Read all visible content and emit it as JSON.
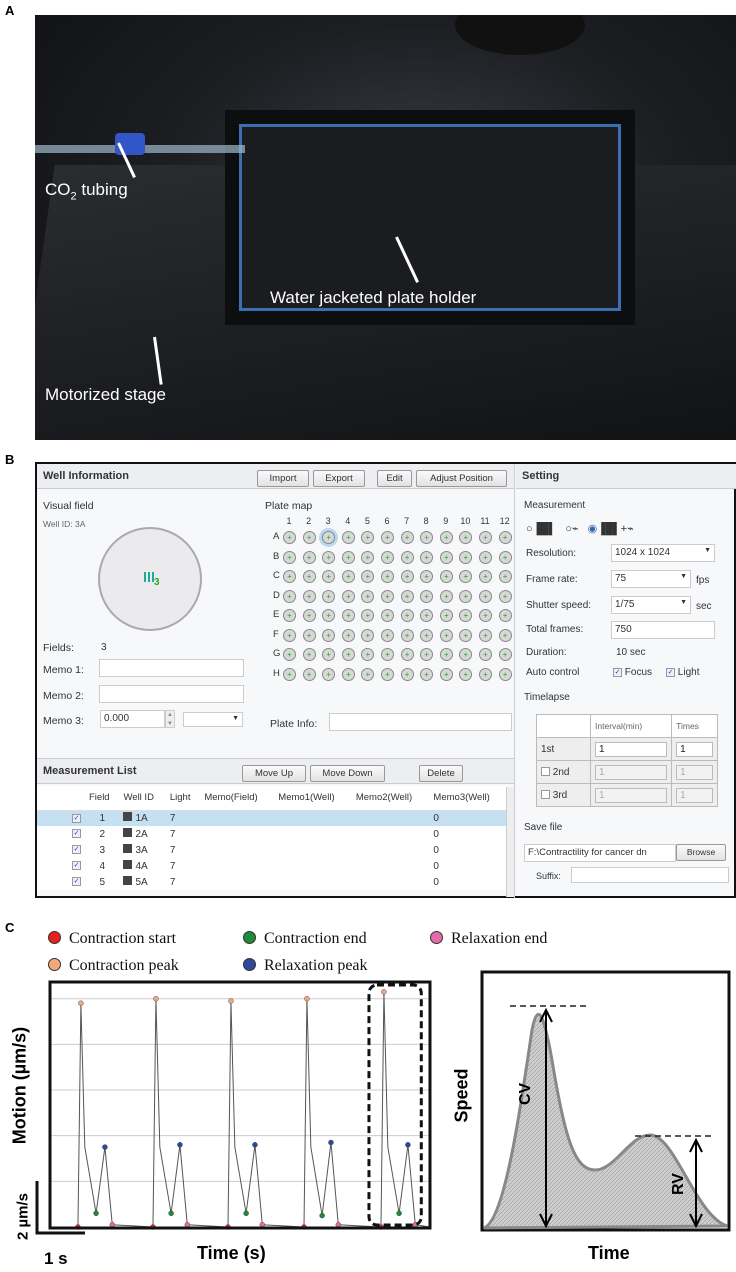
{
  "panels": {
    "a": "A",
    "b": "B",
    "c": "C"
  },
  "photo": {
    "labels": {
      "co2_main": "CO",
      "co2_sub": "2",
      "co2_rest": " tubing",
      "holder": "Water jacketed plate holder",
      "stage": "Motorized stage"
    }
  },
  "well_info": {
    "title": "Well Information",
    "buttons": {
      "import": "Import",
      "export": "Export",
      "edit": "Edit",
      "adjust": "Adjust Position"
    },
    "visual_field": "Visual field",
    "well_id_label": "Well ID:",
    "well_id": "3A",
    "field_marker": "3",
    "fields_label": "Fields:",
    "fields": "3",
    "memo1_label": "Memo 1:",
    "memo1": "",
    "memo2_label": "Memo 2:",
    "memo2": "",
    "memo3_label": "Memo 3:",
    "memo3": "0.000",
    "plate_map": "Plate map",
    "plate_info_label": "Plate Info:",
    "plate_info": "",
    "columns": [
      "1",
      "2",
      "3",
      "4",
      "5",
      "6",
      "7",
      "8",
      "9",
      "10",
      "11",
      "12"
    ],
    "rows": [
      "A",
      "B",
      "C",
      "D",
      "E",
      "F",
      "G",
      "H"
    ],
    "selected_well": "A3"
  },
  "measurement_list": {
    "title": "Measurement List",
    "buttons": {
      "move_up": "Move Up",
      "move_down": "Move Down",
      "delete": "Delete"
    },
    "headers": [
      "",
      "Field",
      "Well ID",
      "Light",
      "Memo(Field)",
      "Memo1(Well)",
      "Memo2(Well)",
      "Memo3(Well)"
    ],
    "rows": [
      {
        "checked": true,
        "field": "1",
        "well": "1A",
        "light": "7",
        "memo3": "0",
        "selected": true
      },
      {
        "checked": true,
        "field": "2",
        "well": "2A",
        "light": "7",
        "memo3": "0"
      },
      {
        "checked": true,
        "field": "3",
        "well": "3A",
        "light": "7",
        "memo3": "0"
      },
      {
        "checked": true,
        "field": "4",
        "well": "4A",
        "light": "7",
        "memo3": "0"
      },
      {
        "checked": true,
        "field": "5",
        "well": "5A",
        "light": "7",
        "memo3": "0"
      }
    ]
  },
  "setting": {
    "title": "Setting",
    "measurement": "Measurement",
    "mode_selected": "video+graph",
    "plus": "+",
    "resolution_label": "Resolution:",
    "resolution": "1024 x 1024",
    "frame_rate_label": "Frame rate:",
    "frame_rate": "75",
    "fps": "fps",
    "shutter_label": "Shutter speed:",
    "shutter": "1/75",
    "sec": "sec",
    "total_frames_label": "Total frames:",
    "total_frames": "750",
    "duration_label": "Duration:",
    "duration": "10 sec",
    "auto_control": "Auto control",
    "focus": "Focus",
    "light": "Light",
    "timelapse": "Timelapse",
    "tl_headers": [
      "",
      "Interval(min)",
      "Times"
    ],
    "tl_rows": [
      {
        "label": "1st",
        "interval": "1",
        "times": "1"
      },
      {
        "label": "2nd",
        "interval": "1",
        "times": "1"
      },
      {
        "label": "3rd",
        "interval": "1",
        "times": "1"
      }
    ],
    "save_file": "Save file",
    "path": "F:\\Contractility for cancer dn",
    "browse": "Browse",
    "suffix_label": "Suffix:",
    "suffix": ""
  },
  "chart_data": [
    {
      "type": "line",
      "xlabel": "Time (s)",
      "ylabel": "Motion (µm/s)",
      "scale_bars": {
        "y": "2 µm/s",
        "x": "1 s"
      },
      "legend": [
        {
          "name": "Contraction start",
          "color": "#e82020"
        },
        {
          "name": "Contraction end",
          "color": "#1f8a3a"
        },
        {
          "name": "Relaxation end",
          "color": "#e46ba8"
        },
        {
          "name": "Contraction peak",
          "color": "#f2a878"
        },
        {
          "name": "Relaxation peak",
          "color": "#2e48a0"
        }
      ],
      "cycles": [
        {
          "contraction_start": [
            0.57,
            0
          ],
          "contraction_peak": [
            0.63,
            9.8
          ],
          "contraction_end": [
            0.94,
            0.6
          ],
          "relaxation_peak": [
            1.12,
            3.5
          ],
          "relaxation_end": [
            1.27,
            0.1
          ]
        },
        {
          "contraction_start": [
            2.1,
            0
          ],
          "contraction_peak": [
            2.16,
            10.0
          ],
          "contraction_end": [
            2.47,
            0.6
          ],
          "relaxation_peak": [
            2.65,
            3.6
          ],
          "relaxation_end": [
            2.8,
            0.1
          ]
        },
        {
          "contraction_start": [
            3.63,
            0
          ],
          "contraction_peak": [
            3.69,
            9.9
          ],
          "contraction_end": [
            4.0,
            0.6
          ],
          "relaxation_peak": [
            4.18,
            3.6
          ],
          "relaxation_end": [
            4.33,
            0.1
          ]
        },
        {
          "contraction_start": [
            5.18,
            0
          ],
          "contraction_peak": [
            5.24,
            10.0
          ],
          "contraction_end": [
            5.55,
            0.5
          ],
          "relaxation_peak": [
            5.73,
            3.7
          ],
          "relaxation_end": [
            5.88,
            0.1
          ]
        },
        {
          "contraction_start": [
            6.75,
            0
          ],
          "contraction_peak": [
            6.81,
            10.3
          ],
          "contraction_end": [
            7.12,
            0.6
          ],
          "relaxation_peak": [
            7.3,
            3.6
          ],
          "relaxation_end": [
            7.45,
            0.1
          ]
        }
      ],
      "xlim": [
        0,
        7.75
      ],
      "ylim": [
        0,
        10.6
      ],
      "grid": true,
      "highlighted_cycle": 5
    },
    {
      "type": "area",
      "xlabel": "Time",
      "ylabel": "Speed",
      "annotations": [
        "CV",
        "RV"
      ]
    }
  ]
}
